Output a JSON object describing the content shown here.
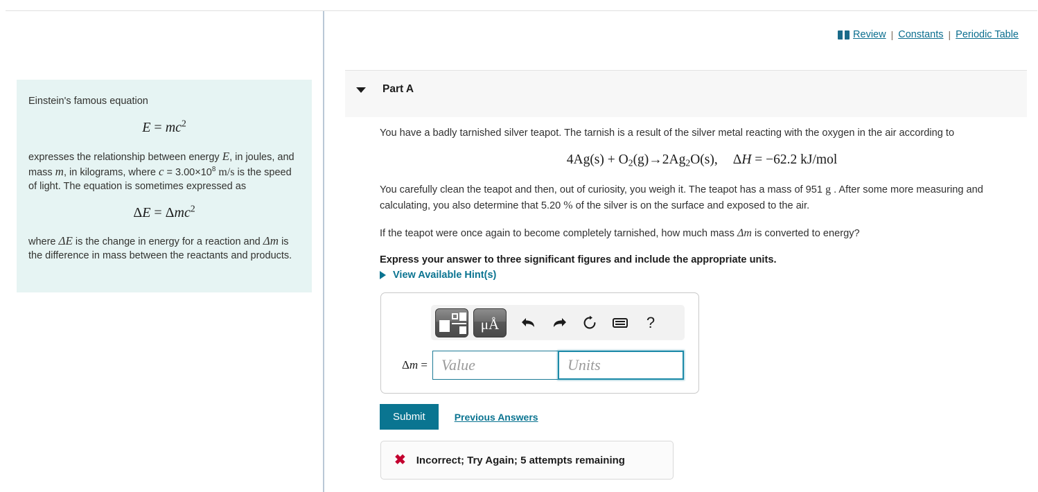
{
  "top_links": {
    "book_icon": "book-icon",
    "review": "Review",
    "constants": "Constants",
    "periodic_table": "Periodic Table",
    "separator": "|"
  },
  "info_panel": {
    "intro": "Einstein's famous equation",
    "equation_1": "E = mc²",
    "paragraph_1_a": "expresses the relationship between energy ",
    "paragraph_1_E": "E",
    "paragraph_1_b": ", in joules, and mass ",
    "paragraph_1_m": "m",
    "paragraph_1_c": ", in kilograms, where ",
    "paragraph_1_cvar": "c",
    "paragraph_1_d": " = 3.00×10",
    "paragraph_1_exp": "8",
    "paragraph_1_units": " m/s",
    "paragraph_1_e": " is the speed of light. The equation is sometimes expressed as",
    "equation_2": "ΔE = Δmc²",
    "paragraph_2_a": "where ",
    "paragraph_2_dE": "ΔE",
    "paragraph_2_b": " is the change in energy for a reaction and ",
    "paragraph_2_dm": "Δm",
    "paragraph_2_c": " is the difference in mass between the reactants and products."
  },
  "part": {
    "title": "Part A",
    "caret": "chevron-down-icon",
    "prompt_1": "You have a badly tarnished silver teapot. The tarnish is a result of the silver metal reacting with the oxygen in the air according to",
    "reaction": "4Ag(s) + O₂(g)→2Ag₂O(s),",
    "enthalpy": "ΔH = −62.2 kJ/mol",
    "prompt_2_a": "You carefully clean the teapot and then, out of curiosity, you weigh it. The teapot has a mass of 951 ",
    "prompt_2_unit": "g",
    "prompt_2_b": " . After some more measuring and calculating, you also determine that 5.20 ",
    "prompt_2_percent": "%",
    "prompt_2_c": " of the silver is on the surface and exposed to the air.",
    "prompt_3_a": "If the teapot were once again to become completely tarnished, how much mass ",
    "prompt_3_dm": "Δm",
    "prompt_3_b": " is converted to energy?",
    "instruction": "Express your answer to three significant figures and include the appropriate units."
  },
  "hints": {
    "label": "View Available Hint(s)",
    "triangle": "triangle-right-icon"
  },
  "math_toolbar": {
    "template_button": "math-template-icon",
    "units_button": "μÅ",
    "undo": "undo-arrow-icon",
    "redo": "redo-arrow-icon",
    "reset": "reset-circle-icon",
    "keyboard": "keyboard-icon",
    "help": "?"
  },
  "answer": {
    "label_delta": "Δ",
    "label_m": "m",
    "label_eq": " =",
    "value_placeholder": "Value",
    "value_text": "",
    "units_placeholder": "Units",
    "units_text": ""
  },
  "actions": {
    "submit": "Submit",
    "previous_answers": "Previous Answers"
  },
  "feedback": {
    "icon": "x-mark-icon",
    "symbol": "✖",
    "message": "Incorrect; Try Again; 5 attempts remaining"
  },
  "colors": {
    "accent_teal": "#0a7591",
    "link_teal": "#0b7491",
    "info_panel_bg": "#e6f4f3",
    "part_header_bg": "#f7f7f7",
    "error_red": "#c3002f"
  }
}
